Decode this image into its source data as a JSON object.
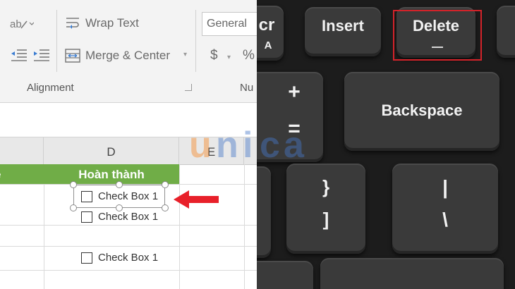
{
  "excel": {
    "ribbon": {
      "wrap_text": "Wrap Text",
      "merge_center": "Merge & Center",
      "number_format": "General",
      "currency_symbol": "$",
      "percent_symbol": "%",
      "group_alignment": "Alignment",
      "group_number": "Nu"
    },
    "columns": [
      "D",
      "E"
    ],
    "header_cells": {
      "c_tail": "e",
      "d": "Hoàn thành"
    },
    "checkboxes": [
      {
        "label": "Check Box 1",
        "selected": true
      },
      {
        "label": "Check Box 1",
        "selected": false
      },
      {
        "label": "Check Box 1",
        "selected": false
      }
    ],
    "colors": {
      "header_fill": "#70ad47",
      "arrow": "#e8202a"
    }
  },
  "keyboard": {
    "keys": {
      "prtscr": "cr",
      "prtscr_sub": "A",
      "insert": "Insert",
      "delete": "Delete",
      "plus": "+",
      "equals": "=",
      "backspace": "Backspace",
      "brace": "}",
      "bracket": "]",
      "pipe": "|",
      "backslash": "\\"
    },
    "highlight_color": "#d4232a"
  },
  "watermark": {
    "letters": [
      "u",
      "n",
      "i",
      "c",
      "a"
    ]
  }
}
